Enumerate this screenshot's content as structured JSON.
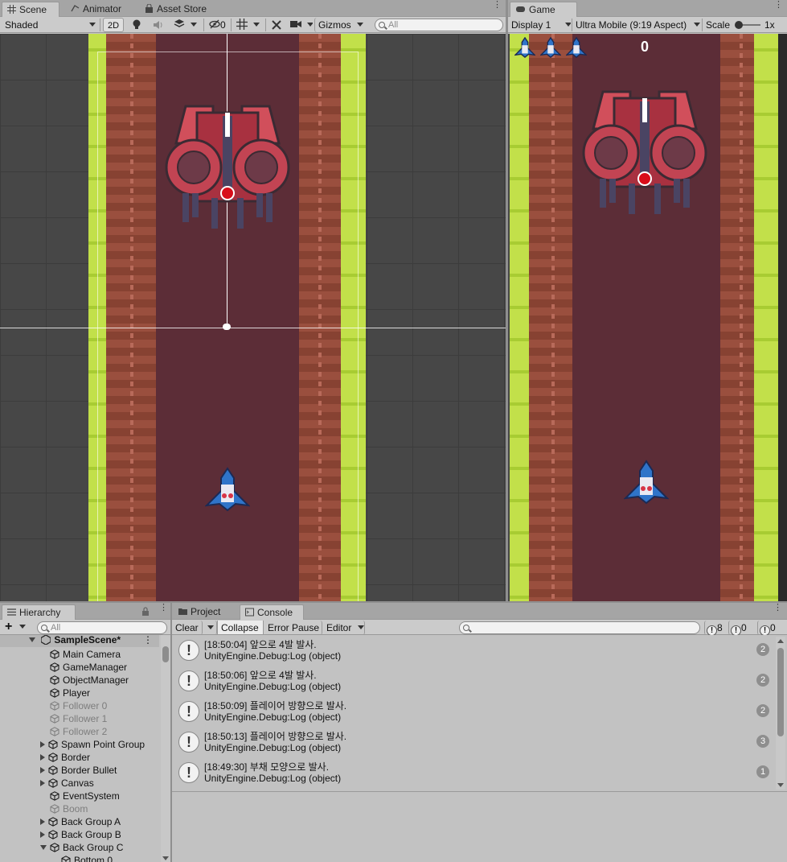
{
  "scene_tabs": [
    {
      "label": "Scene",
      "icon": "grid-icon"
    },
    {
      "label": "Animator",
      "icon": "animator-icon"
    },
    {
      "label": "Asset Store",
      "icon": "store-bag-icon"
    }
  ],
  "scene_toolbar": {
    "shading_mode": "Shaded",
    "mode_2d": "2D",
    "hidden_count": "0",
    "gizmos": "Gizmos",
    "search_placeholder": "All"
  },
  "game_tab": {
    "label": "Game",
    "icon": "gamepad-icon"
  },
  "game_toolbar": {
    "display": "Display 1",
    "aspect": "Ultra Mobile (9:19 Aspect)",
    "scale_label": "Scale",
    "scale_value": "1x"
  },
  "game_view": {
    "score": "0",
    "lives": 3
  },
  "hierarchy": {
    "tab_label": "Hierarchy",
    "add_label": "+",
    "search_placeholder": "All",
    "scene_name": "SampleScene*",
    "items": [
      {
        "label": "Main Camera",
        "dim": false,
        "expand": "none"
      },
      {
        "label": "GameManager",
        "dim": false,
        "expand": "none"
      },
      {
        "label": "ObjectManager",
        "dim": false,
        "expand": "none"
      },
      {
        "label": "Player",
        "dim": false,
        "expand": "none"
      },
      {
        "label": "Follower 0",
        "dim": true,
        "expand": "none"
      },
      {
        "label": "Follower 1",
        "dim": true,
        "expand": "none"
      },
      {
        "label": "Follower 2",
        "dim": true,
        "expand": "none"
      },
      {
        "label": "Spawn Point Group",
        "dim": false,
        "expand": "collapsed"
      },
      {
        "label": "Border",
        "dim": false,
        "expand": "collapsed"
      },
      {
        "label": "Border Bullet",
        "dim": false,
        "expand": "collapsed"
      },
      {
        "label": "Canvas",
        "dim": false,
        "expand": "collapsed"
      },
      {
        "label": "EventSystem",
        "dim": false,
        "expand": "none"
      },
      {
        "label": "Boom",
        "dim": true,
        "expand": "none"
      },
      {
        "label": "Back Group A",
        "dim": false,
        "expand": "collapsed"
      },
      {
        "label": "Back Group B",
        "dim": false,
        "expand": "collapsed"
      },
      {
        "label": "Back Group C",
        "dim": false,
        "expand": "expanded"
      },
      {
        "label": "Bottom 0",
        "dim": false,
        "expand": "child"
      }
    ]
  },
  "console": {
    "tabs": [
      {
        "label": "Project",
        "icon": "folder-icon"
      },
      {
        "label": "Console",
        "icon": "console-icon"
      }
    ],
    "toolbar": {
      "clear": "Clear",
      "collapse": "Collapse",
      "error_pause": "Error Pause",
      "editor": "Editor",
      "warn_count": "8",
      "info_count": "0",
      "error_count": "0"
    },
    "logs": [
      {
        "line1": "[18:50:04] 앞으로 4발 발사.",
        "line2": "UnityEngine.Debug:Log (object)",
        "count": "2"
      },
      {
        "line1": "[18:50:06] 앞으로 4발 발사.",
        "line2": "UnityEngine.Debug:Log (object)",
        "count": "2"
      },
      {
        "line1": "[18:50:09] 플레이어 방향으로 발사.",
        "line2": "UnityEngine.Debug:Log (object)",
        "count": "2"
      },
      {
        "line1": "[18:50:13] 플레이어 방향으로 발사.",
        "line2": "UnityEngine.Debug:Log (object)",
        "count": "3"
      },
      {
        "line1": "[18:49:30] 부채 모양으로 발사.",
        "line2": "UnityEngine.Debug:Log (object)",
        "count": "1"
      }
    ]
  }
}
